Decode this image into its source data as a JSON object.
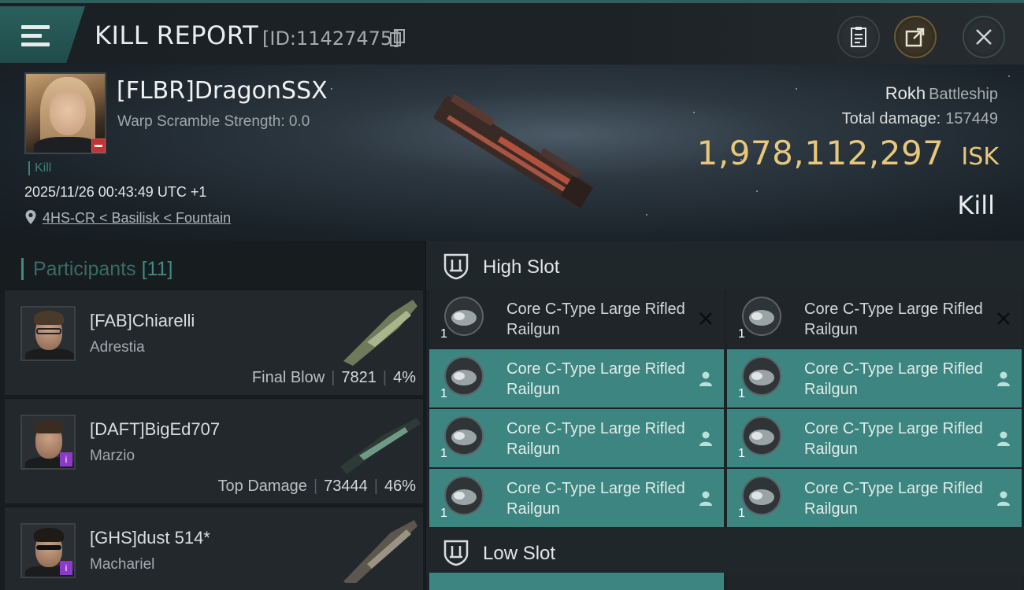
{
  "header": {
    "title": "KILL REPORT",
    "report_id": "[ID:11427475]"
  },
  "victim": {
    "name": "[FLBR]DragonSSX",
    "warp_scramble": "Warp Scramble Strength: 0.0",
    "tag": "Kill",
    "datetime": "2025/11/26 00:43:49 UTC +1",
    "location": "4HS-CR < Basilisk < Fountain",
    "ship_name": "Rokh",
    "ship_class": "Battleship",
    "total_damage_label": "Total damage:",
    "total_damage": "157449",
    "isk_value": "1,978,112,297",
    "isk_unit": "ISK",
    "result": "Kill"
  },
  "participants": {
    "label": "Participants",
    "count": "[11]",
    "items": [
      {
        "name": "[FAB]Chiarelli",
        "ship": "Adrestia",
        "role": "Final Blow",
        "damage": "7821",
        "percent": "4%"
      },
      {
        "name": "[DAFT]BigEd707",
        "ship": "Marzio",
        "role": "Top Damage",
        "damage": "73444",
        "percent": "46%"
      },
      {
        "name": "[GHS]dust 514*",
        "ship": "Machariel",
        "role": "",
        "damage": "",
        "percent": ""
      }
    ]
  },
  "slots": {
    "high_title": "High Slot",
    "low_title": "Low Slot",
    "high_modules": [
      {
        "name": "Core C-Type Large Rifled Railgun",
        "qty": "1",
        "state": "destroyed"
      },
      {
        "name": "Core C-Type Large Rifled Railgun",
        "qty": "1",
        "state": "destroyed"
      },
      {
        "name": "Core C-Type Large Rifled Railgun",
        "qty": "1",
        "state": "dropped"
      },
      {
        "name": "Core C-Type Large Rifled Railgun",
        "qty": "1",
        "state": "dropped"
      },
      {
        "name": "Core C-Type Large Rifled Railgun",
        "qty": "1",
        "state": "dropped"
      },
      {
        "name": "Core C-Type Large Rifled Railgun",
        "qty": "1",
        "state": "dropped"
      },
      {
        "name": "Core C-Type Large Rifled Railgun",
        "qty": "1",
        "state": "dropped"
      },
      {
        "name": "Core C-Type Large Rifled Railgun",
        "qty": "1",
        "state": "dropped"
      }
    ]
  },
  "colors": {
    "accent_teal": "#3d8580",
    "isk_gold": "#e8c77a",
    "header_bg": "#1b2024"
  },
  "icons": [
    "menu-icon",
    "copy-icon",
    "clipboard-icon",
    "share-icon",
    "close-icon",
    "location-pin-icon",
    "high-slot-icon",
    "low-slot-icon",
    "module-railgun-icon",
    "destroyed-x-icon",
    "dropped-person-icon"
  ]
}
